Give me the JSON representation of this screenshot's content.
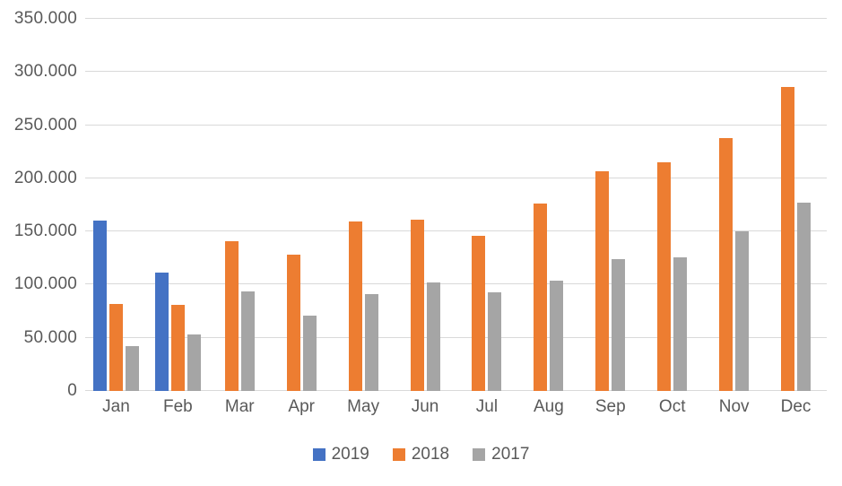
{
  "chart_data": {
    "type": "bar",
    "title": "",
    "subtitle": "",
    "xlabel": "",
    "ylabel": "",
    "categories": [
      "Jan",
      "Feb",
      "Mar",
      "Apr",
      "May",
      "Jun",
      "Jul",
      "Aug",
      "Sep",
      "Oct",
      "Nov",
      "Dec"
    ],
    "series": [
      {
        "name": "2019",
        "color": "#4472C4",
        "values": [
          160000,
          111000,
          null,
          null,
          null,
          null,
          null,
          null,
          null,
          null,
          null,
          null
        ]
      },
      {
        "name": "2018",
        "color": "#ED7D31",
        "values": [
          82000,
          81000,
          141000,
          128000,
          159000,
          161000,
          146000,
          176000,
          207000,
          215000,
          238000,
          286000
        ]
      },
      {
        "name": "2017",
        "color": "#A5A5A5",
        "values": [
          42000,
          53000,
          94000,
          71000,
          91000,
          102000,
          93000,
          104000,
          124000,
          126000,
          150000,
          177000
        ]
      }
    ],
    "ylim": [
      0,
      350000
    ],
    "ytick_values": [
      0,
      50000,
      100000,
      150000,
      200000,
      250000,
      300000,
      350000
    ],
    "ytick_labels": [
      "0",
      "50.000",
      "100.000",
      "150.000",
      "200.000",
      "250.000",
      "300.000",
      "350.000"
    ],
    "grid": true,
    "legend_position": "bottom",
    "legend_entries": [
      "2019",
      "2018",
      "2017"
    ],
    "annotations": []
  },
  "axis": {
    "gridline_color": "#D9D9D9",
    "tick_text_color": "#595959"
  }
}
